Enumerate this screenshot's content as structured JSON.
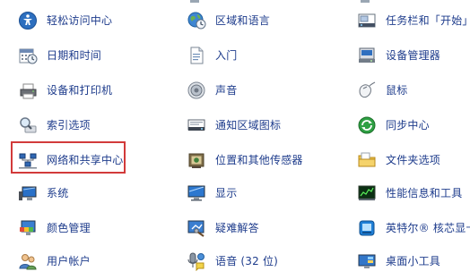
{
  "columns": [
    {
      "items": [
        {
          "label": "轻松访问中心",
          "icon": "ease-of-access-icon"
        },
        {
          "label": "日期和时间",
          "icon": "calendar-clock-icon"
        },
        {
          "label": "设备和打印机",
          "icon": "printer-icon"
        },
        {
          "label": "索引选项",
          "icon": "magnifier-icon"
        },
        {
          "label": "网络和共享中心",
          "icon": "network-icon"
        },
        {
          "label": "系统",
          "icon": "computer-monitor-icon"
        },
        {
          "label": "颜色管理",
          "icon": "color-management-icon"
        },
        {
          "label": "用户帐户",
          "icon": "users-icon"
        }
      ]
    },
    {
      "items": [
        {
          "label": "区域和语言",
          "icon": "globe-clock-icon"
        },
        {
          "label": "入门",
          "icon": "document-icon"
        },
        {
          "label": "声音",
          "icon": "speaker-icon"
        },
        {
          "label": "通知区域图标",
          "icon": "taskbar-icon"
        },
        {
          "label": "位置和其他传感器",
          "icon": "sensor-icon"
        },
        {
          "label": "显示",
          "icon": "display-icon"
        },
        {
          "label": "疑难解答",
          "icon": "troubleshoot-icon"
        },
        {
          "label": "语音 (32 位)",
          "icon": "speech-icon"
        }
      ]
    },
    {
      "items": [
        {
          "label": "任务栏和「开始」",
          "icon": "taskbar-start-icon"
        },
        {
          "label": "设备管理器",
          "icon": "device-manager-icon"
        },
        {
          "label": "鼠标",
          "icon": "mouse-icon"
        },
        {
          "label": "同步中心",
          "icon": "sync-icon"
        },
        {
          "label": "文件夹选项",
          "icon": "folder-icon"
        },
        {
          "label": "性能信息和工具",
          "icon": "performance-icon"
        },
        {
          "label": "英特尔® 核芯显卡",
          "icon": "intel-graphics-icon"
        },
        {
          "label": "桌面小工具",
          "icon": "gadgets-icon"
        }
      ]
    }
  ],
  "highlighted_item": "网络和共享中心",
  "colors": {
    "link_text": "#1e3c8c",
    "highlight_border": "#d23a3a",
    "background": "#ffffff"
  }
}
